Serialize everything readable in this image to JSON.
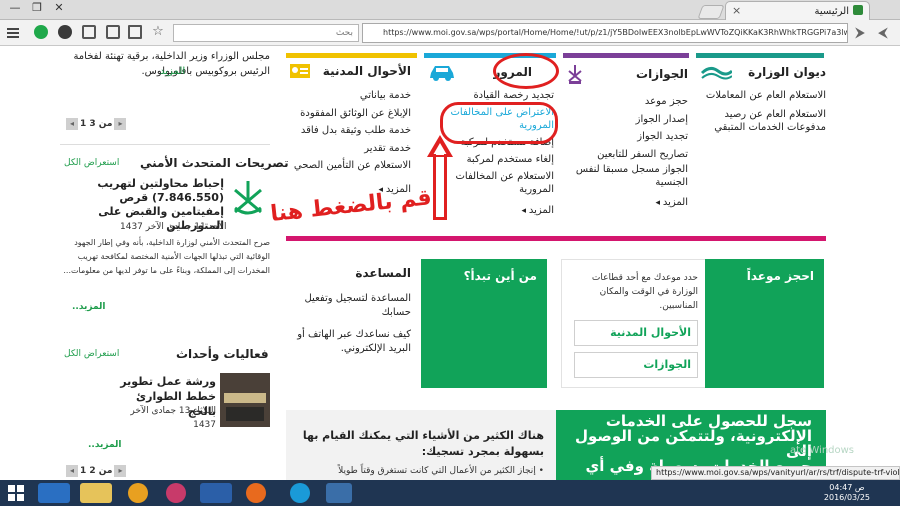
{
  "browser": {
    "tab_title": "الرئيسية",
    "tab_close": "×",
    "window_controls": [
      "—",
      "❐",
      "✕"
    ],
    "search_placeholder": "بحث",
    "url": "https://www.moi.gov.sa/wps/portal/Home/Home/!ut/p/z1/jY5BDoIwEEX3nolbEpLwWVToZQiKKaK3RhWhkTRGGPi7a3lwg3oX0xmM"
  },
  "columns": [
    {
      "title": "ديوان الوزارة",
      "color": "#1a9a8a",
      "icon": "ministry-wave-icon",
      "links": [
        "الاستعلام العام عن المعاملات",
        "الاستعلام العام عن رصيد مدفوعات الخدمات المتبقي"
      ]
    },
    {
      "title": "الجوازات",
      "color": "#7b3f98",
      "icon": "passports-emblem-icon",
      "links": [
        "حجز موعد",
        "إصدار الجواز",
        "تجديد الجواز",
        "تصاريح السفر للتابعين",
        "الجواز مسجل مسبقا لنفس الجنسية"
      ],
      "more": "المزيد"
    },
    {
      "title": "المرور",
      "color": "#1aa8d8",
      "icon": "car-icon",
      "links": [
        "تجديد رخصة القيادة",
        "الاعتراض على المخالفات المرورية",
        "إضافة مستخدم لمركبة",
        "إلغاء مستخدم لمركبة",
        "الاستعلام عن المخالفات المرورية"
      ],
      "more": "المزيد"
    },
    {
      "title": "الأحوال المدنية",
      "color": "#f0c200",
      "icon": "id-card-icon",
      "links": [
        "خدمة بياناتي",
        "الإبلاغ عن الوثائق المفقودة",
        "خدمة طلب وثيقة بدل فاقد",
        "خدمة تقدير",
        "الاستعلام عن التأمين الصحي"
      ],
      "more": "المزيد"
    }
  ],
  "annotation": {
    "callout": "قم بالضغط هنا"
  },
  "appointment": {
    "title": "احجز موعداً",
    "text": "حدد موعدك مع أحد قطاعات الوزارة في الوقت والمكان المناسبين.",
    "btn_civil": "الأحوال المدنية",
    "btn_passports": "الجوازات"
  },
  "start": {
    "title": "من أين تبدأ؟"
  },
  "help": {
    "title": "المساعدة",
    "line1": "المساعدة لتسجيل وتفعيل حسابك",
    "line2": "كيف نساعدك عبر الهاتف أو البريد الإلكتروني."
  },
  "register": {
    "line1": "سجل للحصول على الخدمات",
    "line2": "الإلكترونية، ولتتمكن من الوصول إلى",
    "line3": "جميع الخدمات بسهولة وفي أي وقت."
  },
  "things": {
    "title": "هناك الكثير من الأشياء التي يمكنك القيام بها بسهولة بمجرد تسجيك:",
    "bullet": "• إنجاز الكثير من الأعمال التي كانت تستغرق وقتاً طويلاً"
  },
  "sidebar": {
    "top_text1": "مجلس الوزراء وزير الداخلية، برقية تهنئة لفخامة",
    "top_text2": "الرئيس بروكوبيس بافلوبولوس.",
    "top_more": "المزيد",
    "pager1": "1 من 3",
    "security_head": "تصريحات المتحدث الأمني",
    "view_all": "استعراض الكل",
    "security_title": "إحباط محاولتين لتهريب (7.846.550) قرص إمفيتامين والقبض على المتورطين",
    "security_date": "الأحد 11 جمادى الآخر 1437",
    "security_body": "صرح المتحدث الأمني لوزارة الداخلية، بأنه وفي إطار الجهود الوقائية التي تبذلها الجهات الأمنية المختصة لمكافحة تهريب المخدرات إلى المملكة، وبناءً على ما توفر لديها من معلومات...",
    "security_more": "المزيد..",
    "events_head": "فعاليات وأحداث",
    "events_view_all": "استعراض الكل",
    "event_title": "ورشة عمل تطوير خطط الطوارئ بالحج",
    "event_date": "الثلاثاء 13 جمادى الآخر 1437",
    "events_more": "المزيد..",
    "pager2": "1 من 2"
  },
  "status": {
    "url": "https://www.moi.gov.sa/wps/vanityurl/ar/rs/trf/dispute-trf-violations",
    "watermark": "ate Windows"
  },
  "clock": {
    "time": "04:47 ص",
    "date": "2016/03/25"
  }
}
